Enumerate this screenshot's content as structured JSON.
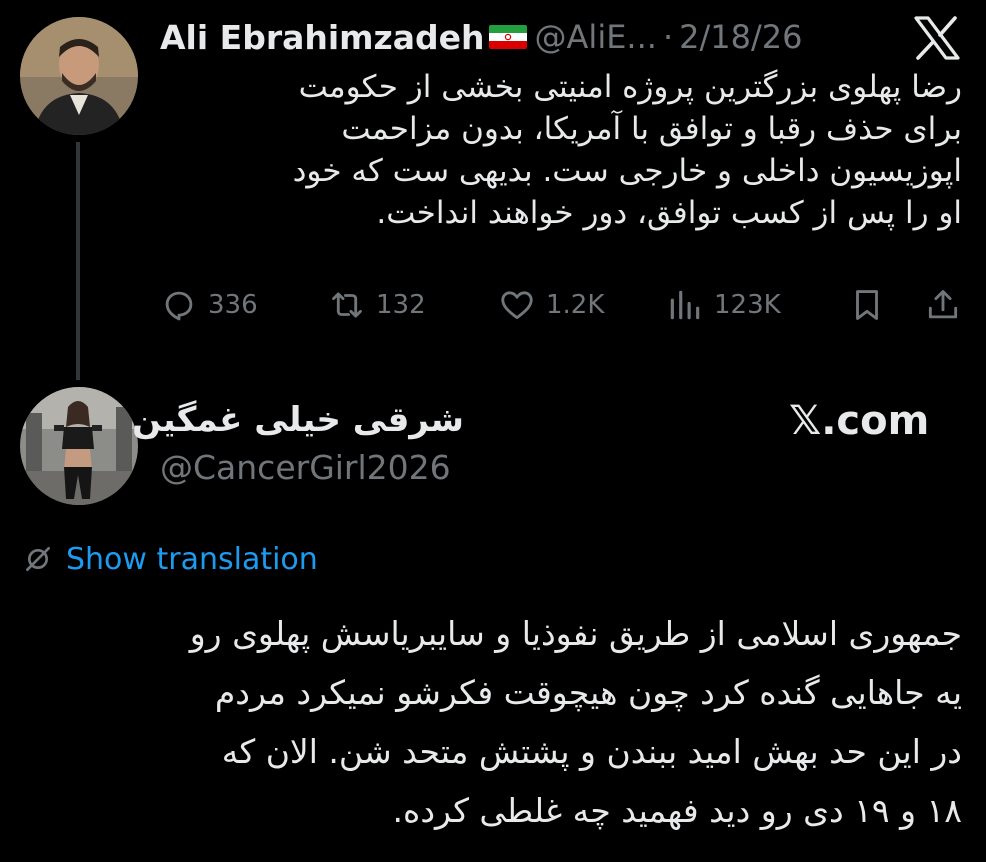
{
  "tweet1": {
    "author_name": "Ali Ebrahimzadeh",
    "handle": "@AliE...",
    "separator": "·",
    "date": "2/18/26",
    "flag_icon": "iran-flag-icon",
    "lines": [
      "رضا پهلوی بزرگترین پروژه امنیتی بخشی از حکومت",
      "برای حذف رقبا و توافق با آمریکا، بدون مزاحمت",
      "اپوزیسیون داخلی و خارجی ست. بدیهی ست که خود",
      "او را پس از کسب توافق، دور خواهند انداخت."
    ],
    "actions": {
      "replies": "336",
      "reposts": "132",
      "likes": "1.2K",
      "views": "123K"
    }
  },
  "tweet2": {
    "author_name": "شرقی خیلی غمگین",
    "handle": "@CancerGirl2026",
    "watermark": "𝕏.com",
    "translate_label": "Show translation",
    "lines": [
      "جمهوری اسلامی از طریق نفوذیا و سایبریاسش پهلوی رو",
      "یه جاهایی گنده کرد چون هیچوقت فکرشو نمیکرد مردم",
      "در این حد بهش امید ببندن و پشتش متحد شن. الان که",
      "۱۸ و ۱۹ دی رو دید فهمید چه غلطی کرده."
    ]
  },
  "colors": {
    "background": "#000000",
    "text": "#e7e9ea",
    "muted": "#71767b",
    "accent": "#1d9bf0",
    "thread_line": "#333639"
  }
}
